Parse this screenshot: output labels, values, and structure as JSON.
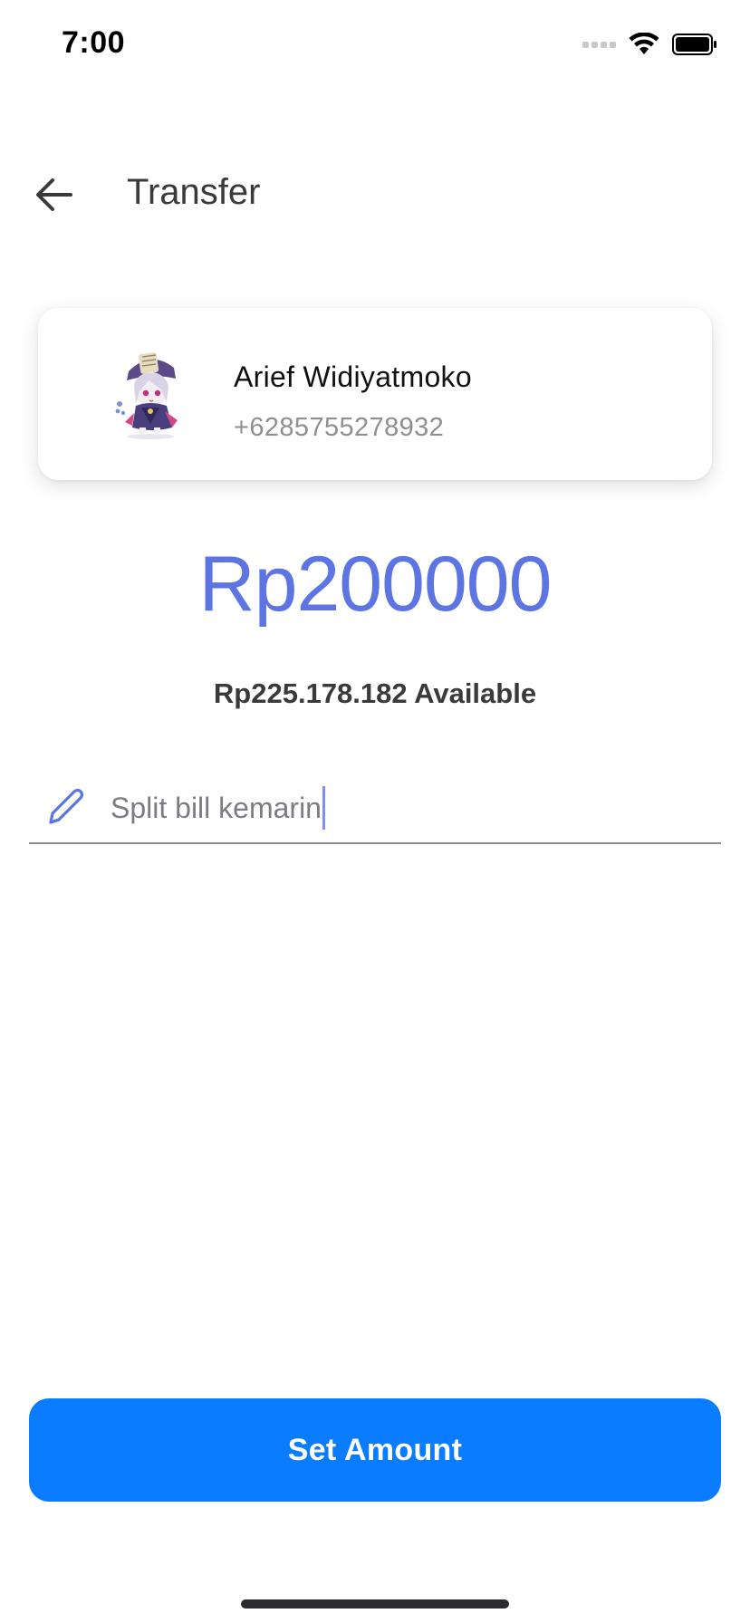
{
  "status_bar": {
    "time": "7:00"
  },
  "header": {
    "title": "Transfer",
    "back_icon": "arrow-left-icon"
  },
  "recipient": {
    "name": "Arief Widiyatmoko",
    "phone": "+6285755278932"
  },
  "amount": {
    "value": "Rp200000",
    "available": "Rp225.178.182 Available"
  },
  "note": {
    "icon": "pencil-icon",
    "value": "Split bill kemarin"
  },
  "actions": {
    "set_amount_label": "Set Amount"
  },
  "colors": {
    "accent": "#5d75e3",
    "primary_button": "#0a7cff",
    "secondary_text": "#8e8e93"
  }
}
